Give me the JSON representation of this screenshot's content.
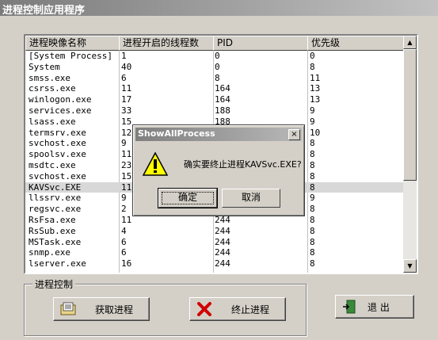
{
  "window": {
    "title": "进程控制应用程序"
  },
  "list": {
    "columns": [
      "进程映像名称",
      "进程开启的线程数",
      "PID",
      "优先级"
    ],
    "rows": [
      [
        "[System Process]",
        "1",
        "0",
        "0"
      ],
      [
        "System",
        "40",
        "0",
        "8"
      ],
      [
        "smss.exe",
        "6",
        "8",
        "11"
      ],
      [
        "csrss.exe",
        "11",
        "164",
        "13"
      ],
      [
        "winlogon.exe",
        "17",
        "164",
        "13"
      ],
      [
        "services.exe",
        "33",
        "188",
        "9"
      ],
      [
        "lsass.exe",
        "15",
        "188",
        "9"
      ],
      [
        "termsrv.exe",
        "12",
        "",
        "10"
      ],
      [
        "svchost.exe",
        "9",
        "",
        "8"
      ],
      [
        "spoolsv.exe",
        "11",
        "",
        "8"
      ],
      [
        "msdtc.exe",
        "23",
        "",
        "8"
      ],
      [
        "svchost.exe",
        "15",
        "",
        "8"
      ],
      [
        "KAVSvc.EXE",
        "11",
        "",
        "8"
      ],
      [
        "llssrv.exe",
        "9",
        "",
        "9"
      ],
      [
        "regsvc.exe",
        "2",
        "",
        "8"
      ],
      [
        "RsFsa.exe",
        "11",
        "244",
        "8"
      ],
      [
        "RsSub.exe",
        "4",
        "244",
        "8"
      ],
      [
        "MSTask.exe",
        "6",
        "244",
        "8"
      ],
      [
        "snmp.exe",
        "6",
        "244",
        "8"
      ],
      [
        "lserver.exe",
        "16",
        "244",
        "8"
      ]
    ],
    "selected_row": 12
  },
  "group": {
    "legend": "进程控制"
  },
  "buttons": {
    "get": "获取进程",
    "kill": "终止进程",
    "exit": "退  出"
  },
  "dialog": {
    "title": "ShowAllProcess",
    "close": "×",
    "message": "确实要终止进程KAVSvc.EXE?",
    "ok": "确定",
    "cancel": "取消"
  },
  "icons": {
    "dialog": "warning-icon",
    "get": "folder-list-icon",
    "kill": "red-x-icon",
    "exit": "exit-door-icon"
  }
}
